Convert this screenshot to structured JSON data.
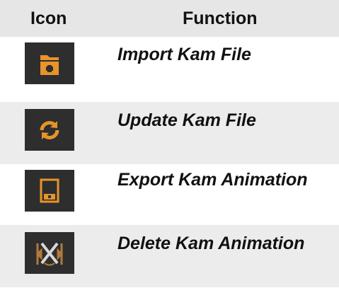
{
  "header": {
    "icon_col": "Icon",
    "function_col": "Function"
  },
  "rows": [
    {
      "icon": "folder-add-icon",
      "label": "Import Kam File"
    },
    {
      "icon": "refresh-icon",
      "label": "Update Kam File"
    },
    {
      "icon": "save-icon",
      "label": "Export Kam Animation"
    },
    {
      "icon": "delete-icon",
      "label": "Delete Kam Animation"
    }
  ],
  "colors": {
    "icon_bg": "#2e2e2e",
    "icon_orange": "#e8942a",
    "header_bg": "#e6e6e6",
    "row_shade": "#ececec"
  }
}
